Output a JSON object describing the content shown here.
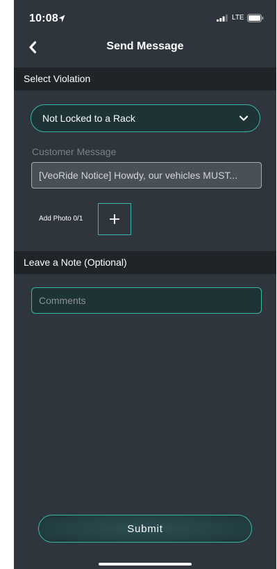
{
  "status_bar": {
    "time": "10:08",
    "network": "LTE"
  },
  "nav": {
    "title": "Send Message",
    "back_icon": "chevron-left-icon"
  },
  "violation_section": {
    "header": "Select Violation",
    "selected_value": "Not Locked to a Rack",
    "dropdown_icon": "chevron-down-icon"
  },
  "customer_message": {
    "label": "Customer Message",
    "value": "[VeoRide Notice] Howdy, our vehicles MUST..."
  },
  "add_photo": {
    "label": "Add Photo 0/1",
    "icon": "plus-icon"
  },
  "note_section": {
    "header": "Leave a Note (Optional)",
    "placeholder": "Comments"
  },
  "submit": {
    "label": "Submit"
  },
  "colors": {
    "background": "#2f353c",
    "section_header": "#1f2429",
    "accent": "#3bb5a6",
    "field_fill": "#1d3336"
  }
}
